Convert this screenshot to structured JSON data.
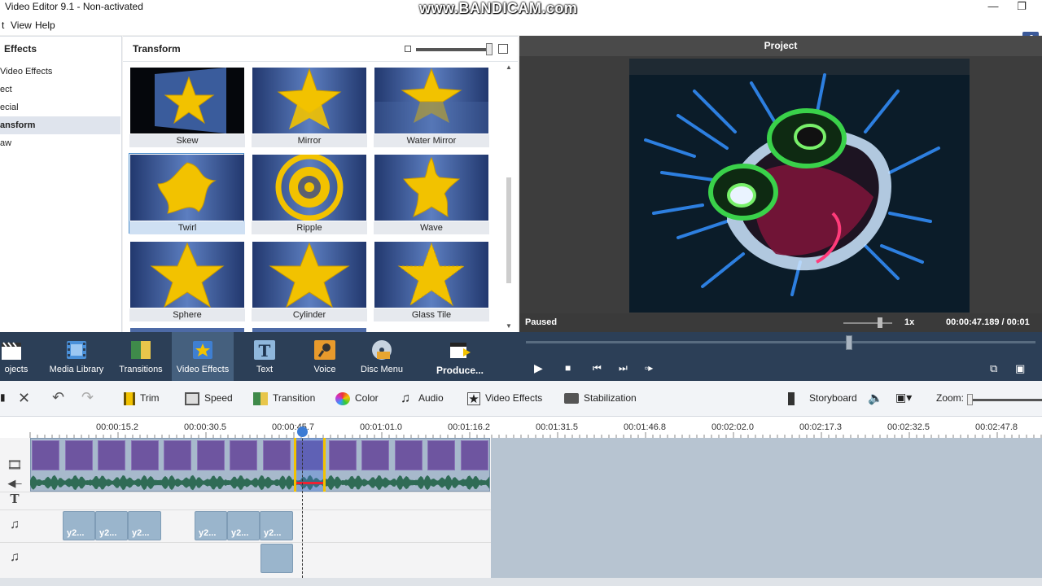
{
  "window": {
    "title": "Video Editor 9.1 - Non-activated",
    "watermark": "www.BANDICAM.com",
    "menu": [
      "t",
      "View",
      "Help"
    ]
  },
  "effects_panel": {
    "header": "Effects",
    "items": [
      "Video Effects",
      "ect",
      "ecial",
      "ansform",
      "aw"
    ],
    "selected_index": 3
  },
  "gallery": {
    "header": "Transform",
    "tiles": [
      {
        "label": "Skew"
      },
      {
        "label": "Mirror"
      },
      {
        "label": "Water Mirror"
      },
      {
        "label": "Twirl"
      },
      {
        "label": "Ripple"
      },
      {
        "label": "Wave"
      },
      {
        "label": "Sphere"
      },
      {
        "label": "Cylinder"
      },
      {
        "label": "Glass Tile"
      }
    ],
    "selected": "Twirl"
  },
  "preview": {
    "header": "Project",
    "status": "Paused",
    "speed": "1x",
    "time": "00:00:47.189  /  00:01"
  },
  "toolbar": {
    "items": [
      "ojects",
      "Media Library",
      "Transitions",
      "Video Effects",
      "Text",
      "Voice",
      "Disc Menu",
      "Produce..."
    ],
    "selected": "Video Effects"
  },
  "edit_toolbar": {
    "trim": "Trim",
    "speed": "Speed",
    "transition": "Transition",
    "color": "Color",
    "audio": "Audio",
    "video_effects": "Video Effects",
    "stabilization": "Stabilization",
    "storyboard": "Storyboard",
    "zoom": "Zoom:"
  },
  "timeline": {
    "ruler": [
      "00:00:15.2",
      "00:00:30.5",
      "00:00:45.7",
      "00:01:01.0",
      "00:01:16.2",
      "00:01:31.5",
      "00:01:46.8",
      "00:02:02.0",
      "00:02:17.3",
      "00:02:32.5",
      "00:02:47.8"
    ],
    "audio_clip_label": "y2..."
  },
  "colors": {
    "toolbar_bg": "#2c3f57",
    "accent": "#3b7bd4",
    "video_clip": "#6e55a0",
    "star": "#f2c200"
  }
}
